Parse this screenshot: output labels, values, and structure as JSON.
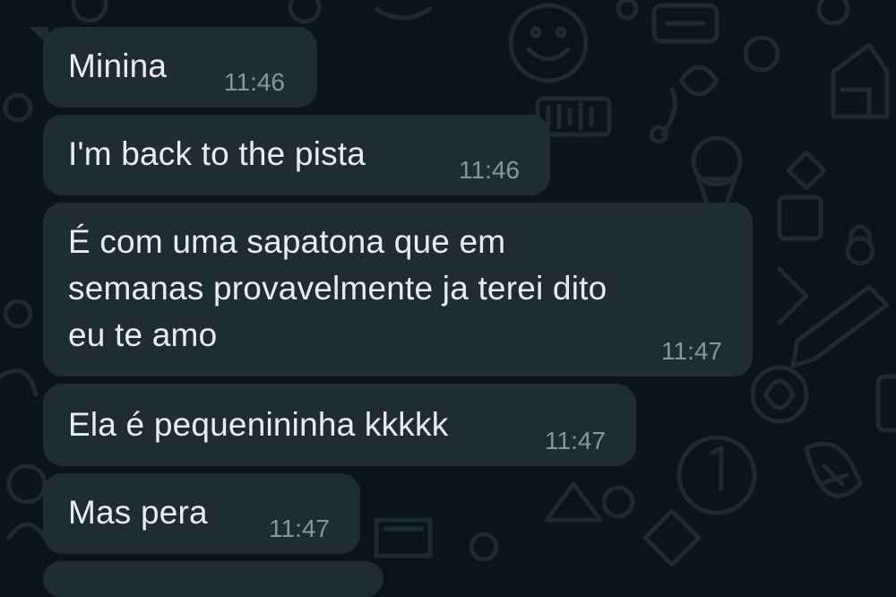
{
  "chat": {
    "messages": [
      {
        "text": "Minina",
        "time": "11:46"
      },
      {
        "text": "I'm back to the pista",
        "time": "11:46"
      },
      {
        "text": "É com uma sapatona que em\nsemanas provavelmente ja terei dito\neu te amo",
        "time": "11:47"
      },
      {
        "text": "Ela é pequenininha kkkkk",
        "time": "11:47"
      },
      {
        "text": "Mas pera",
        "time": "11:47"
      }
    ]
  },
  "colors": {
    "background": "#0b141a",
    "bubble_incoming": "#202c33",
    "text": "#e9edef",
    "timestamp": "#8696a0",
    "wallpaper_doodle": "#1c2a31"
  },
  "icons": [
    "wallpaper-doodle-pattern"
  ]
}
